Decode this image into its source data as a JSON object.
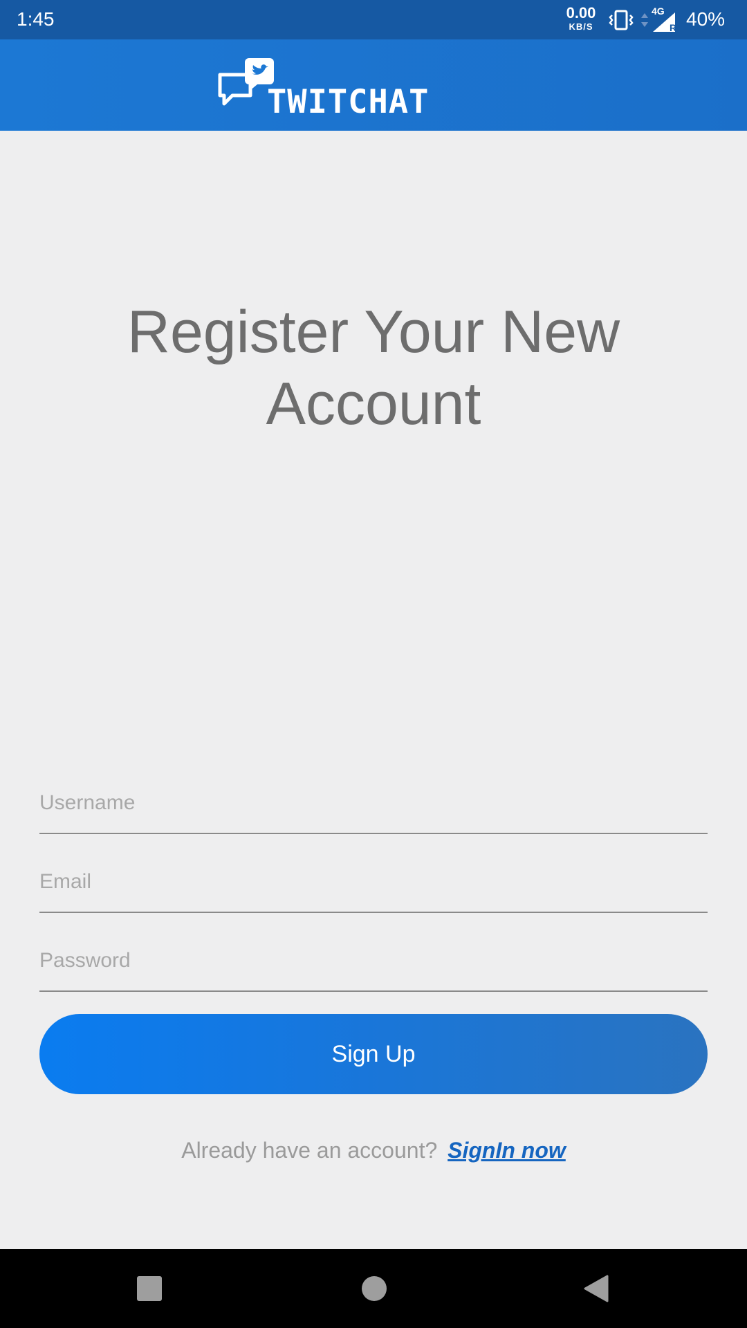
{
  "status_bar": {
    "time": "1:45",
    "net_rate": "0.00",
    "net_unit": "KB/S",
    "network_type": "4G",
    "roaming": "R",
    "battery": "40%",
    "icons": [
      "vibrate-icon",
      "data-arrows-icon",
      "signal-icon"
    ]
  },
  "app_bar": {
    "logo_text": "TWITCHAT",
    "logo_icon": "chat-bubbles-bird-icon",
    "color": "#1c78d4"
  },
  "page": {
    "title": "Register Your New Account"
  },
  "form": {
    "username_placeholder": "Username",
    "username_value": "",
    "email_placeholder": "Email",
    "email_value": "",
    "password_placeholder": "Password",
    "password_value": "",
    "signup_label": "Sign Up",
    "button_color": "#0a7cf0"
  },
  "footer": {
    "prompt": "Already have an account?",
    "link_label": "SignIn now",
    "link_color": "#1565c0"
  },
  "nav_bar": {
    "icons": [
      "recents-icon",
      "home-icon",
      "back-icon"
    ]
  }
}
